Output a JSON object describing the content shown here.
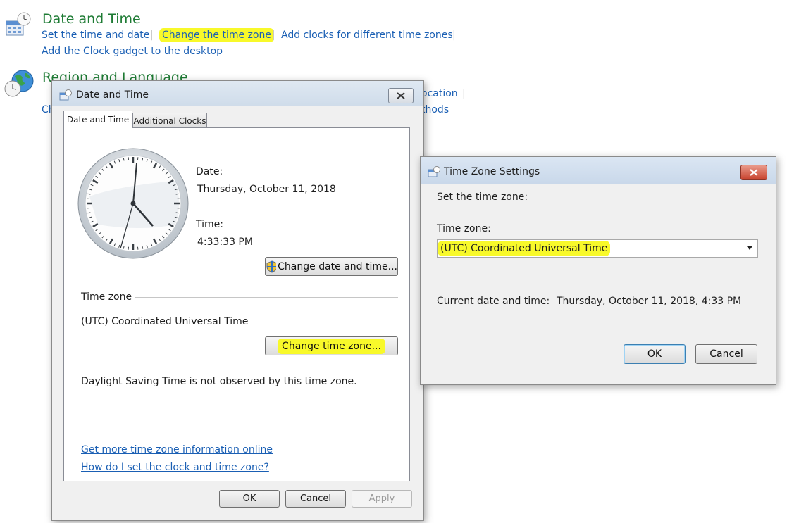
{
  "control_panel": {
    "date_time": {
      "title": "Date and Time",
      "links": [
        "Set the time and date",
        "Change the time zone",
        "Add clocks for different time zones",
        "Add the Clock gadget to the desktop"
      ]
    },
    "region": {
      "title": "Region and Language",
      "partial_links": [
        "ocation",
        "Ch",
        "thods"
      ]
    }
  },
  "date_time_dialog": {
    "title": "Date and Time",
    "tabs": [
      "Date and Time",
      "Additional Clocks"
    ],
    "active_tab": "Date and Time",
    "date_label": "Date:",
    "date_value": "Thursday, October 11, 2018",
    "time_label": "Time:",
    "time_value": "4:33:33 PM",
    "change_datetime_button": "Change date and time...",
    "timezone_group": "Time zone",
    "timezone_value": "(UTC) Coordinated Universal Time",
    "change_timezone_button": "Change time zone...",
    "dst_note": "Daylight Saving Time is not observed by this time zone.",
    "links": [
      "Get more time zone information online",
      "How do I set the clock and time zone?"
    ],
    "buttons": {
      "ok": "OK",
      "cancel": "Cancel",
      "apply": "Apply"
    }
  },
  "tz_dialog": {
    "title": "Time Zone Settings",
    "prompt": "Set the time zone:",
    "timezone_label": "Time zone:",
    "timezone_selected": "(UTC) Coordinated Universal Time",
    "current_label": "Current date and time:",
    "current_value": "Thursday, October 11, 2018, 4:33 PM",
    "buttons": {
      "ok": "OK",
      "cancel": "Cancel"
    }
  },
  "colors": {
    "highlight": "#f8f92a",
    "link": "#1a5fb4",
    "heading": "#1e7b34"
  },
  "icons": [
    "calendar-clock-icon",
    "globe-clock-icon",
    "shield-icon",
    "window-app-icon",
    "close-icon",
    "dropdown-arrow-icon"
  ]
}
